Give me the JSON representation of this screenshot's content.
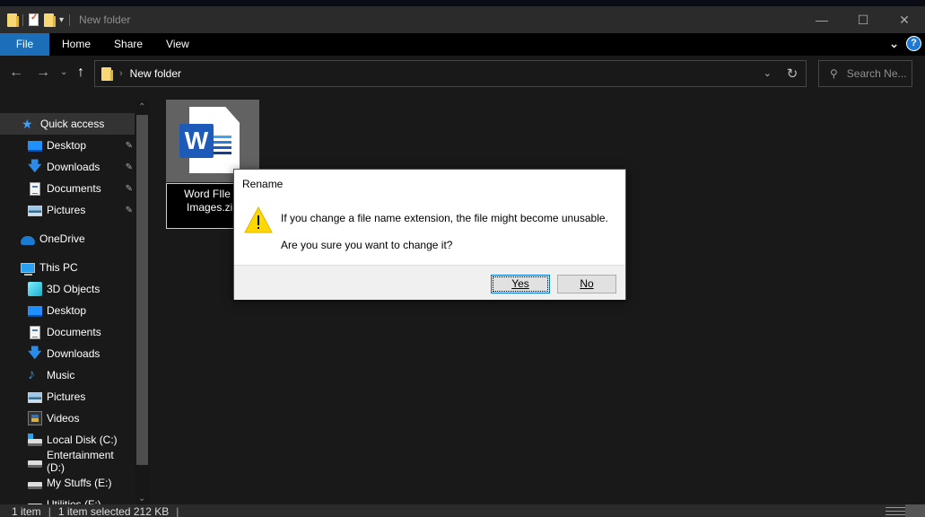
{
  "window": {
    "title": "New folder",
    "controls": {
      "minimize": "—",
      "maximize": "☐",
      "close": "✕"
    }
  },
  "quick_access_toolbar": {
    "dropdown": "▾"
  },
  "ribbon": {
    "tabs": [
      {
        "label": "File",
        "active": true
      },
      {
        "label": "Home"
      },
      {
        "label": "Share"
      },
      {
        "label": "View"
      }
    ],
    "expand_icon": "⌄",
    "help_icon": "?"
  },
  "navigation": {
    "back": "←",
    "forward": "→",
    "recent": "⌄",
    "up": "↑",
    "breadcrumb": [
      "New folder"
    ],
    "breadcrumb_sep": "›",
    "address_dropdown": "⌄",
    "refresh": "↻",
    "search_placeholder": "Search Ne..."
  },
  "sidebar": {
    "items": [
      {
        "label": "Quick access",
        "icon": "star-icon",
        "selected": true,
        "pinned": false
      },
      {
        "label": "Desktop",
        "icon": "desktop-icon",
        "pinned": true
      },
      {
        "label": "Downloads",
        "icon": "downloads-icon",
        "pinned": true
      },
      {
        "label": "Documents",
        "icon": "documents-icon",
        "pinned": true
      },
      {
        "label": "Pictures",
        "icon": "pictures-icon",
        "pinned": true
      },
      {
        "label": "OneDrive",
        "icon": "onedrive-icon"
      },
      {
        "label": "This PC",
        "icon": "this-pc-icon"
      },
      {
        "label": "3D Objects",
        "icon": "3d-objects-icon"
      },
      {
        "label": "Desktop",
        "icon": "desktop-icon"
      },
      {
        "label": "Documents",
        "icon": "documents-icon"
      },
      {
        "label": "Downloads",
        "icon": "downloads-icon"
      },
      {
        "label": "Music",
        "icon": "music-icon"
      },
      {
        "label": "Pictures",
        "icon": "pictures-icon"
      },
      {
        "label": "Videos",
        "icon": "videos-icon"
      },
      {
        "label": "Local Disk (C:)",
        "icon": "local-disk-icon"
      },
      {
        "label": "Entertainment (D:)",
        "icon": "drive-icon"
      },
      {
        "label": "My Stuffs (E:)",
        "icon": "drive-icon"
      },
      {
        "label": "Utilities (F:)",
        "icon": "drive-icon"
      }
    ],
    "pin_glyph": "📌"
  },
  "file": {
    "name_line1": "Word FIle w",
    "name_line2": "Images.zip",
    "icon_letter": "W"
  },
  "dialog": {
    "title": "Rename",
    "message": "If you change a file name extension, the file might become unusable.",
    "question": "Are you sure you want to change it?",
    "yes_label": "Yes",
    "no_label": "No"
  },
  "status": {
    "item_count": "1 item",
    "selection": "1 item selected  212 KB"
  }
}
